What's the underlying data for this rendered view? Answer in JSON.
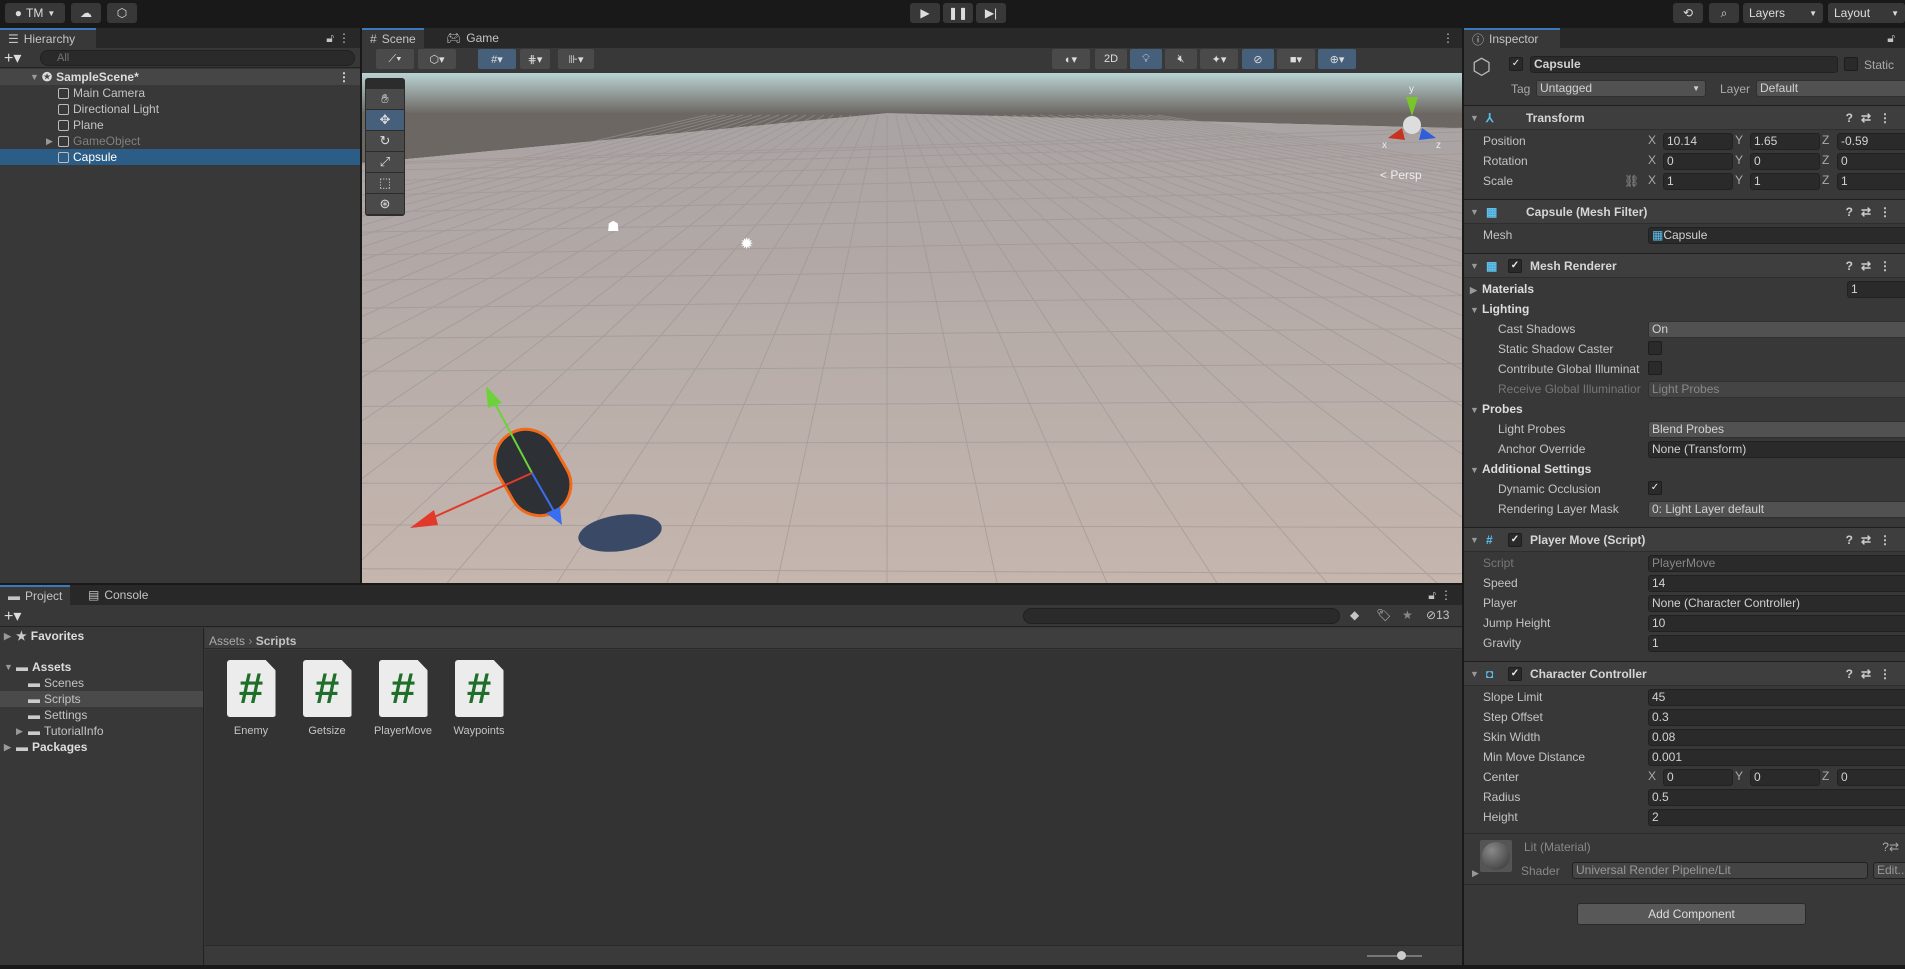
{
  "toolbar": {
    "account": "TM",
    "layers": "Layers",
    "layout": "Layout",
    "icons": [
      "account-icon",
      "cloud-icon",
      "collab-icon",
      "play-icon",
      "pause-icon",
      "step-icon",
      "history-icon",
      "search-icon"
    ]
  },
  "hierarchy": {
    "tab": "Hierarchy",
    "search_placeholder": "All",
    "scene": "SampleScene*",
    "items": [
      {
        "label": "Main Camera",
        "dim": false,
        "sel": false
      },
      {
        "label": "Directional Light",
        "dim": false,
        "sel": false
      },
      {
        "label": "Plane",
        "dim": false,
        "sel": false
      },
      {
        "label": "GameObject",
        "dim": true,
        "sel": false,
        "expand": true
      },
      {
        "label": "Capsule",
        "dim": false,
        "sel": true
      }
    ]
  },
  "scene": {
    "tabs": [
      "Scene",
      "Game"
    ],
    "toggle_2d": "2D",
    "persp": "Persp",
    "axes": [
      "x",
      "y",
      "z"
    ]
  },
  "inspector": {
    "tab": "Inspector",
    "name": "Capsule",
    "static_label": "Static",
    "tag_label": "Tag",
    "tag": "Untagged",
    "layer_label": "Layer",
    "layer": "Default",
    "transform": {
      "title": "Transform",
      "rows": [
        {
          "label": "Position",
          "x": "10.14",
          "y": "1.65",
          "z": "-0.59"
        },
        {
          "label": "Rotation",
          "x": "0",
          "y": "0",
          "z": "0"
        },
        {
          "label": "Scale",
          "x": "1",
          "y": "1",
          "z": "1"
        }
      ]
    },
    "mesh_filter": {
      "title": "Capsule (Mesh Filter)",
      "mesh_label": "Mesh",
      "mesh": "Capsule"
    },
    "mesh_renderer": {
      "title": "Mesh Renderer",
      "rows": [
        {
          "label": "Materials",
          "type": "section-collapsed",
          "value": "1"
        },
        {
          "label": "Lighting",
          "type": "section"
        },
        {
          "label": "Cast Shadows",
          "type": "drop",
          "value": "On"
        },
        {
          "label": "Static Shadow Caster",
          "type": "check",
          "value": ""
        },
        {
          "label": "Contribute Global Illuminat",
          "type": "check",
          "value": ""
        },
        {
          "label": "Receive Global Illuminatior",
          "type": "dropdim",
          "value": "Light Probes"
        },
        {
          "label": "Probes",
          "type": "section"
        },
        {
          "label": "Light Probes",
          "type": "drop",
          "value": "Blend Probes"
        },
        {
          "label": "Anchor Override",
          "type": "obj",
          "value": "None (Transform)"
        },
        {
          "label": "Additional Settings",
          "type": "section"
        },
        {
          "label": "Dynamic Occlusion",
          "type": "check",
          "value": "✓"
        },
        {
          "label": "Rendering Layer Mask",
          "type": "drop",
          "value": "0: Light Layer default"
        }
      ]
    },
    "player_move": {
      "title": "Player Move (Script)",
      "rows": [
        {
          "label": "Script",
          "type": "objdim",
          "value": "PlayerMove"
        },
        {
          "label": "Speed",
          "type": "text",
          "value": "14"
        },
        {
          "label": "Player",
          "type": "obj",
          "value": "None (Character Controller)"
        },
        {
          "label": "Jump Height",
          "type": "text",
          "value": "10"
        },
        {
          "label": "Gravity",
          "type": "text",
          "value": "1"
        }
      ]
    },
    "character_controller": {
      "title": "Character Controller",
      "rows": [
        {
          "label": "Slope Limit",
          "type": "text",
          "value": "45"
        },
        {
          "label": "Step Offset",
          "type": "text",
          "value": "0.3"
        },
        {
          "label": "Skin Width",
          "type": "text",
          "value": "0.08"
        },
        {
          "label": "Min Move Distance",
          "type": "text",
          "value": "0.001"
        },
        {
          "label": "Center",
          "type": "vec",
          "x": "0",
          "y": "0",
          "z": "0"
        },
        {
          "label": "Radius",
          "type": "text",
          "value": "0.5"
        },
        {
          "label": "Height",
          "type": "text",
          "value": "2"
        }
      ]
    },
    "material": {
      "title": "Lit (Material)",
      "shader_label": "Shader",
      "shader": "Universal Render Pipeline/Lit",
      "edit": "Edit..."
    },
    "add_component": "Add Component"
  },
  "project": {
    "tabs": [
      "Project",
      "Console"
    ],
    "hidden_count": "13",
    "tree": [
      {
        "label": "Favorites",
        "level": 0,
        "bold": true,
        "icon": "star"
      },
      {
        "label": "Assets",
        "level": 0,
        "bold": true,
        "icon": "folder-open"
      },
      {
        "label": "Scenes",
        "level": 1
      },
      {
        "label": "Scripts",
        "level": 1,
        "sel": true
      },
      {
        "label": "Settings",
        "level": 1
      },
      {
        "label": "TutorialInfo",
        "level": 1,
        "expand": true
      },
      {
        "label": "Packages",
        "level": 0,
        "bold": true
      }
    ],
    "breadcrumb": [
      "Assets",
      "Scripts"
    ],
    "assets": [
      "Enemy",
      "Getsize",
      "PlayerMove",
      "Waypoints"
    ]
  }
}
